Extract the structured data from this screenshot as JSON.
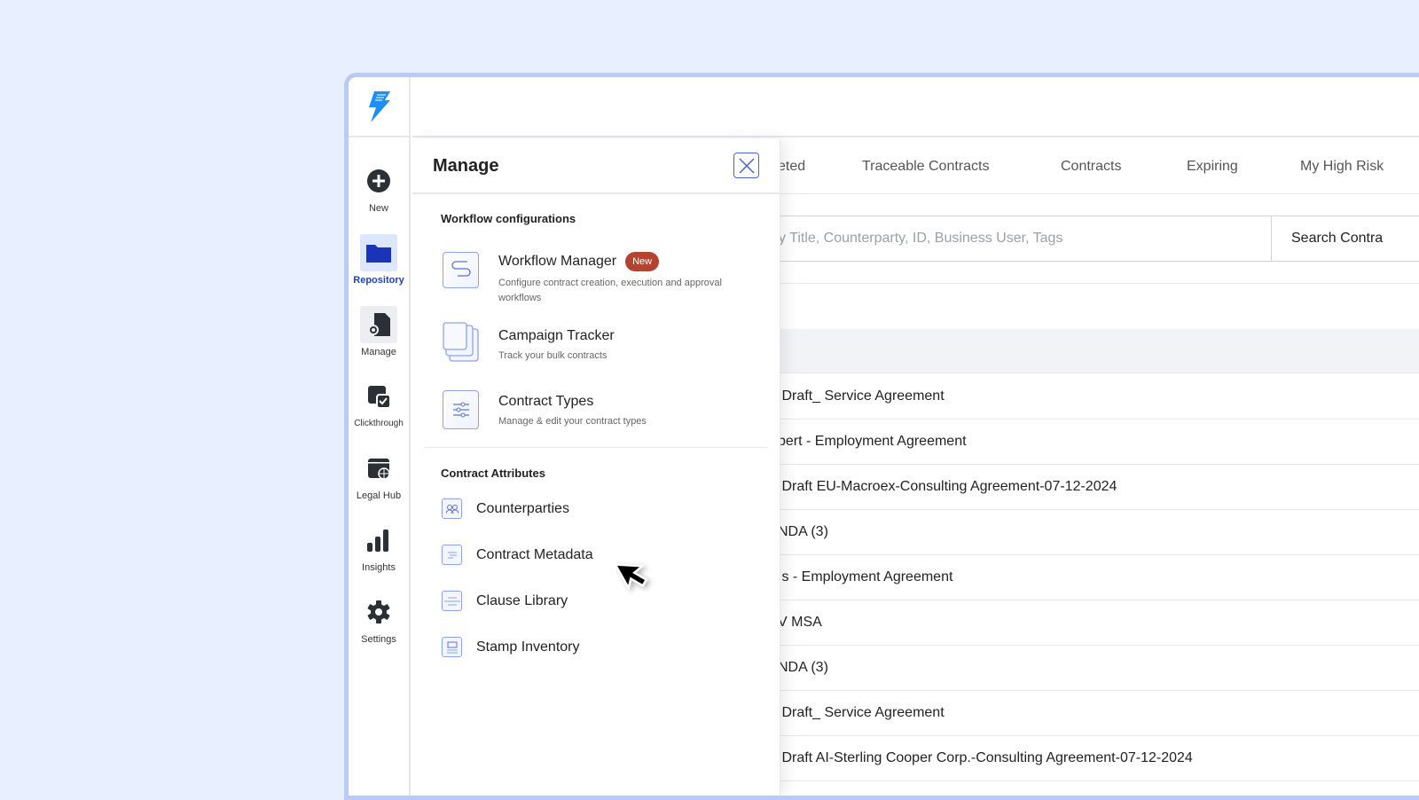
{
  "sidebar": {
    "items": [
      {
        "label": "New"
      },
      {
        "label": "Repository"
      },
      {
        "label": "Manage"
      },
      {
        "label": "Clickthrough"
      },
      {
        "label": "Legal Hub"
      },
      {
        "label": "Insights"
      },
      {
        "label": "Settings"
      }
    ]
  },
  "tabs": [
    "eted",
    "Traceable Contracts",
    "Contracts",
    "Expiring",
    "My High Risk"
  ],
  "search": {
    "placeholder": "y Title, Counterparty, ID, Business User, Tags",
    "button": "Search Contra"
  },
  "rows": [
    ":Draft_ Service Agreement",
    "bert - Employment Agreement",
    ":Draft EU-Macroex-Consulting Agreement-07-12-2024",
    " NDA (3)",
    "ıs - Employment Agreement",
    "V MSA",
    " NDA (3)",
    ":Draft_ Service Agreement",
    ":Draft AI-Sterling Cooper Corp.-Consulting Agreement-07-12-2024"
  ],
  "panel": {
    "title": "Manage",
    "workflow_section": "Workflow configurations",
    "workflow_items": [
      {
        "title": "Workflow Manager",
        "badge": "New",
        "desc": "Configure contract creation, execution and approval workflows"
      },
      {
        "title": "Campaign Tracker",
        "desc": "Track your bulk contracts"
      },
      {
        "title": "Contract Types",
        "desc": "Manage & edit your contract types"
      }
    ],
    "attributes_section": "Contract Attributes",
    "attribute_items": [
      {
        "label": "Counterparties"
      },
      {
        "label": "Contract Metadata"
      },
      {
        "label": "Clause Library"
      },
      {
        "label": "Stamp Inventory"
      }
    ]
  },
  "colors": {
    "accent": "#1f3fc6",
    "badge": "#b5432f",
    "frame": "#b9cbf5"
  }
}
